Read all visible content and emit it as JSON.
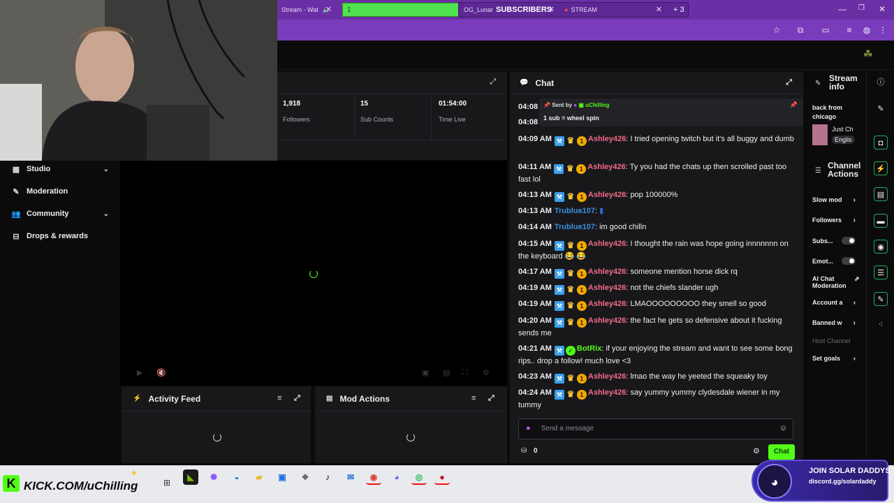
{
  "browser": {
    "tab_stream": "Stream - Wat",
    "tab_green": "1",
    "tab_lunar": "OG_Lunar",
    "tab_subscribers": "SUBSCRIBERS",
    "tab_stream2": "STREAM",
    "tab_plus": "+ 3"
  },
  "sidebar": {
    "items": [
      {
        "label": "Studio"
      },
      {
        "label": "Moderation"
      },
      {
        "label": "Community"
      },
      {
        "label": "Drops & rewards"
      }
    ]
  },
  "stats": {
    "followers": {
      "value": "1,918",
      "label": "Followers"
    },
    "subs": {
      "value": "15",
      "label": "Sub Counts"
    },
    "time": {
      "value": "01:54:00",
      "label": "Time Live"
    }
  },
  "feeds": {
    "activity": "Activity Feed",
    "mod": "Mod Actions"
  },
  "chat": {
    "title": "Chat",
    "pinned": {
      "sent_by": "Sent by",
      "user": "uChilling",
      "text": "1 sub = wheel spin",
      "time1": "04:08",
      "time2": "04:08"
    },
    "messages": [
      {
        "time": "04:09 AM",
        "user": "Ashley426",
        "text": ": I tried opening twitch but it's all buggy and dumb"
      },
      {
        "time": "04:11 AM",
        "user": "Ashley426",
        "text": ": Ty you had the chats up then scrolled past too fast lol"
      },
      {
        "time": "04:13 AM",
        "user": "Ashley426",
        "text": ": pop 100000%"
      },
      {
        "time": "04:13 AM",
        "user": "Trublue107",
        "text": ":"
      },
      {
        "time": "04:14 AM",
        "user": "Trublue107",
        "text": ": im good chilln"
      },
      {
        "time": "04:15 AM",
        "user": "Ashley426",
        "text": ": I thought the rain was hope going innnnnnn on the keyboard 😂 😂"
      },
      {
        "time": "04:17 AM",
        "user": "Ashley426",
        "text": ": someone mention horse dick rq"
      },
      {
        "time": "04:19 AM",
        "user": "Ashley426",
        "text": ": not the chiefs slander ugh"
      },
      {
        "time": "04:19 AM",
        "user": "Ashley426",
        "text": ": LMAOOOOOOOOO they smell so good"
      },
      {
        "time": "04:20 AM",
        "user": "Ashley426",
        "text": ": the fact he gets so defensive about it fucking sends me"
      },
      {
        "time": "04:21 AM",
        "user": "BotRix",
        "text": ": if your enjoying the stream and want to see some bong rips.. drop a follow! much love <3"
      },
      {
        "time": "04:23 AM",
        "user": "Ashley426",
        "text": ": lmao the way he yeeted the squeaky toy"
      },
      {
        "time": "04:24 AM",
        "user": "Ashley426",
        "text": ": say yummy yummy clydesdale wiener in my tummy"
      }
    ],
    "input_placeholder": "Send a message",
    "points": "0",
    "send_label": "Chat"
  },
  "stream_info": {
    "title": "Stream info",
    "stream_title": "back from chicago",
    "category": "Just Ch",
    "language": "Englis"
  },
  "channel_actions": {
    "title": "Channel Actions",
    "items": [
      {
        "label": "Slow mod",
        "kind": "chev"
      },
      {
        "label": "Followers",
        "kind": "chev"
      },
      {
        "label": "Subs...",
        "kind": "toggle"
      },
      {
        "label": "Emot...",
        "kind": "toggle"
      },
      {
        "label": "AI Chat Moderation",
        "kind": "ext"
      },
      {
        "label": "Account a",
        "kind": "chev"
      },
      {
        "label": "Banned w",
        "kind": "chev"
      },
      {
        "label": "Host Channel",
        "kind": "dim"
      },
      {
        "label": "Set goals",
        "kind": "chev"
      }
    ]
  },
  "overlay": {
    "kick_url": "KICK.COM/uChilling",
    "join_title": "JOIN SOLAR DADDYS",
    "join_link": "discord.gg/solardaddy"
  },
  "colors": {
    "accent_green": "#53fc18",
    "tab_purple": "#6b2fa5",
    "ashley": "#f26b8a",
    "trublue": "#3b8fe0"
  }
}
